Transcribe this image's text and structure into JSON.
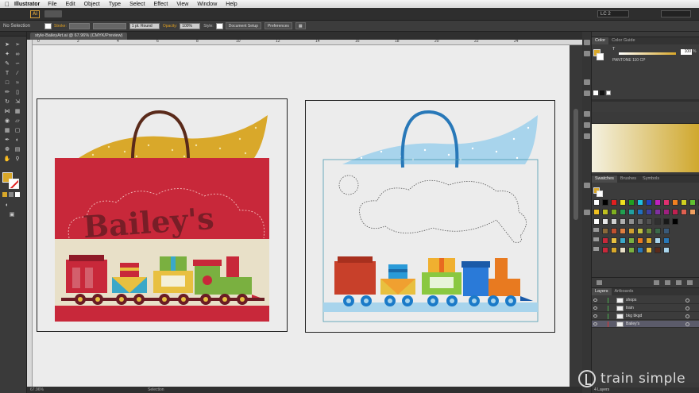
{
  "menubar": {
    "app_name": "Illustrator",
    "items": [
      "File",
      "Edit",
      "Object",
      "Type",
      "Select",
      "Effect",
      "View",
      "Window",
      "Help"
    ]
  },
  "appbar": {
    "logo": "Ai",
    "workspace": "LC 2"
  },
  "controlbar": {
    "selection_label": "No Selection",
    "stroke_label": "Stroke:",
    "stroke_weight": "1 pt. Round",
    "opacity_label": "Opacity:",
    "opacity_value": "100%",
    "style_label": "Style:",
    "document_setup": "Document Setup",
    "preferences": "Preferences"
  },
  "document": {
    "tab_title": "style-BaileyArt.ai @ 67.96% (CMYK/Preview)",
    "zoom": "67.96%",
    "status": "Selection"
  },
  "ruler": {
    "labels": [
      "0",
      "2",
      "4",
      "6",
      "8",
      "10",
      "12",
      "14",
      "16",
      "18",
      "20",
      "22",
      "24"
    ]
  },
  "artwork": {
    "brand_text": "Bailey's",
    "colors": {
      "bag_red": "#c8283a",
      "cream": "#e8e0c8",
      "gold": "#d9a82a",
      "handle_brown": "#5a2a1a",
      "handle_blue": "#2878b8",
      "light_blue": "#a8d4ec"
    }
  },
  "color_panel": {
    "tabs": [
      "Color",
      "Color Guide"
    ],
    "tint_label": "T",
    "tint_value": "100",
    "tint_unit": "%",
    "swatch_name": "PANTONE 110 CP"
  },
  "swatches_panel": {
    "tabs": [
      "Swatches",
      "Brushes",
      "Symbols"
    ]
  },
  "layers_panel": {
    "tabs": [
      "Layers",
      "Artboards"
    ],
    "layers": [
      {
        "name": "shops",
        "color": "#4caf50",
        "selected": false
      },
      {
        "name": "train",
        "color": "#4caf50",
        "selected": false
      },
      {
        "name": "bkg bkgd",
        "color": "#4caf50",
        "selected": false
      },
      {
        "name": "Bailey's",
        "color": "#e03030",
        "selected": true
      }
    ],
    "footer": "4 Layers"
  },
  "watermark": {
    "text": "train simple"
  }
}
